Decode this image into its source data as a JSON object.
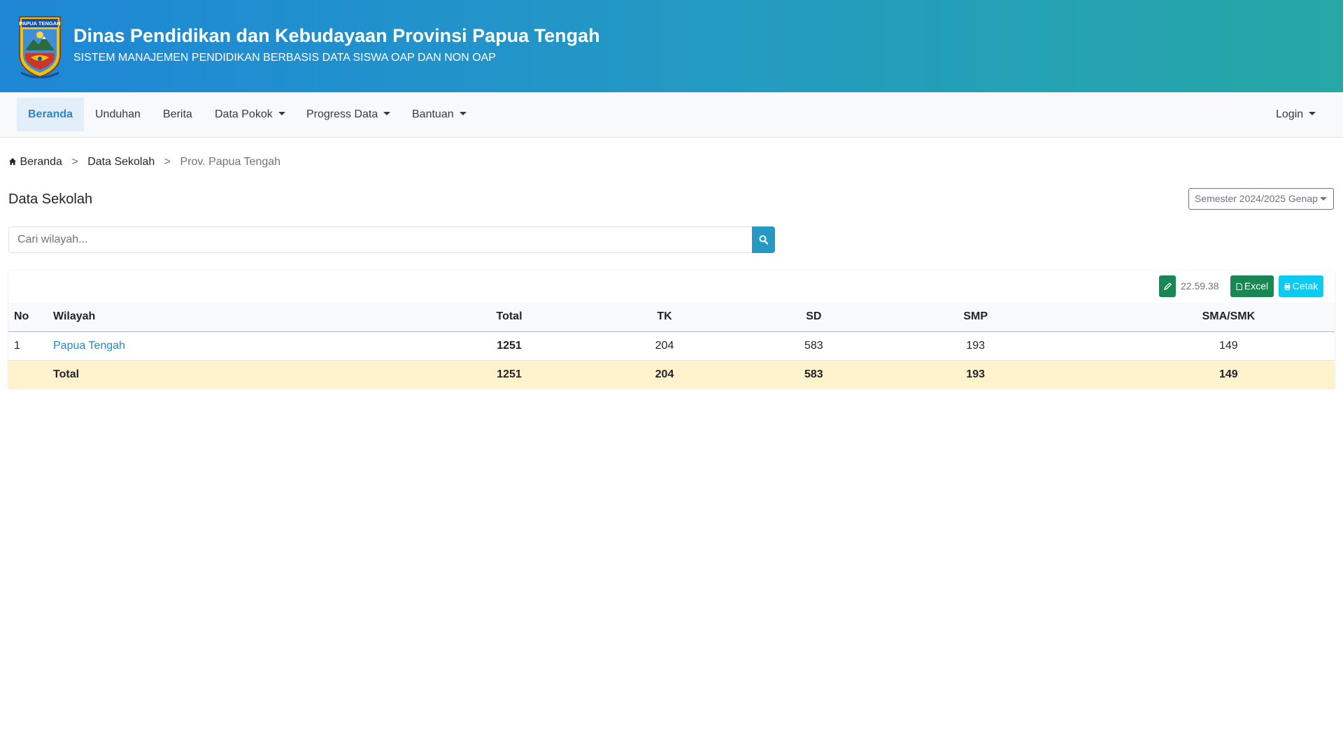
{
  "header": {
    "title": "Dinas Pendidikan dan Kebudayaan Provinsi Papua Tengah",
    "subtitle": "SISTEM MANAJEMEN PENDIDIKAN BERBASIS DATA SISWA OAP DAN NON OAP",
    "logo_text": "PAPUA TENGAH",
    "logo_icon": "provincial-emblem"
  },
  "nav": {
    "items": [
      {
        "label": "Beranda",
        "active": true
      },
      {
        "label": "Unduhan"
      },
      {
        "label": "Berita"
      },
      {
        "label": "Data Pokok",
        "dropdown": true
      },
      {
        "label": "Progress Data",
        "dropdown": true
      },
      {
        "label": "Bantuan",
        "dropdown": true
      }
    ],
    "login_label": "Login"
  },
  "breadcrumb": {
    "home_label": "Beranda",
    "home_icon": "home-icon",
    "separator": ">",
    "level2": "Data Sekolah",
    "current": "Prov. Papua Tengah"
  },
  "page": {
    "title": "Data Sekolah",
    "semester_label": "Semester 2024/2025 Genap"
  },
  "search": {
    "placeholder": "Cari wilayah...",
    "value": "",
    "icon": "search-icon"
  },
  "toolbar": {
    "edit_icon": "pencil-icon",
    "time": "22.59.38",
    "excel_label": "Excel",
    "excel_icon": "file-excel-icon",
    "print_label": "Cetak",
    "print_icon": "printer-icon"
  },
  "table": {
    "headers": [
      "No",
      "Wilayah",
      "Total",
      "TK",
      "SD",
      "SMP",
      "SMA/SMK"
    ],
    "rows": [
      {
        "no": "1",
        "wilayah": "Papua Tengah",
        "total": "1251",
        "tk": "204",
        "sd": "583",
        "smp": "193",
        "sma_smk": "149"
      }
    ],
    "total_row": {
      "label": "Total",
      "total": "1251",
      "tk": "204",
      "sd": "583",
      "smp": "193",
      "sma_smk": "149"
    }
  },
  "colors": {
    "header_gradient_start": "#1e87d6",
    "header_gradient_end": "#27a7a6",
    "link": "#2a86c8",
    "excel_green": "#198754",
    "print_cyan": "#0dcaf0",
    "total_row_bg": "#fff3cd"
  }
}
